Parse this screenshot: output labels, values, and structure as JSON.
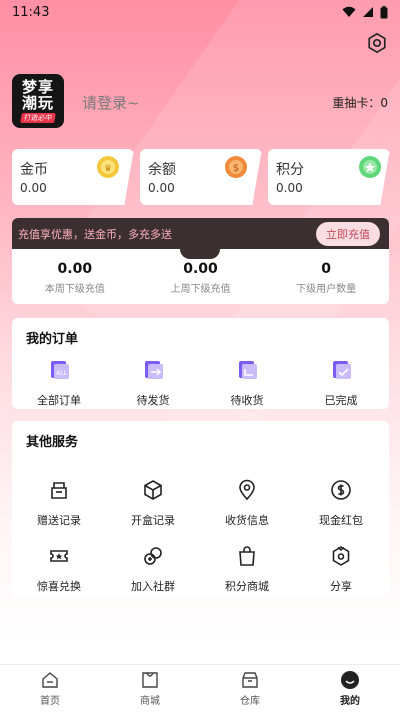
{
  "status_bar": {
    "time": "11:43"
  },
  "profile": {
    "avatar_line1": "梦享",
    "avatar_line2": "潮玩",
    "avatar_tag": "打造必中",
    "login_text": "请登录~",
    "redraw_label": "重抽卡：",
    "redraw_value": "0"
  },
  "wallet": [
    {
      "label": "金币",
      "value": "0.00",
      "icon": "gold-coin-icon",
      "color": "#f4c73a"
    },
    {
      "label": "余额",
      "value": "0.00",
      "icon": "balance-coin-icon",
      "color": "#f08a3a"
    },
    {
      "label": "积分",
      "value": "0.00",
      "icon": "points-star-icon",
      "color": "#5ed67a"
    }
  ],
  "recharge": {
    "message": "充值享优惠，送金币，多充多送",
    "button": "立即充值",
    "stats": [
      {
        "value": "0.00",
        "label": "本周下级充值"
      },
      {
        "value": "0.00",
        "label": "上周下级充值"
      },
      {
        "value": "0",
        "label": "下级用户数量"
      }
    ]
  },
  "orders": {
    "title": "我的订单",
    "items": [
      {
        "label": "全部订单",
        "icon": "all-orders-icon"
      },
      {
        "label": "待发货",
        "icon": "pending-shipment-icon"
      },
      {
        "label": "待收货",
        "icon": "pending-receipt-icon"
      },
      {
        "label": "已完成",
        "icon": "completed-icon"
      }
    ]
  },
  "services": {
    "title": "其他服务",
    "items": [
      {
        "label": "赠送记录",
        "icon": "gift-record-icon"
      },
      {
        "label": "开盒记录",
        "icon": "box-record-icon"
      },
      {
        "label": "收货信息",
        "icon": "location-icon"
      },
      {
        "label": "现金红包",
        "icon": "cash-envelope-icon"
      },
      {
        "label": "惊喜兑换",
        "icon": "ticket-icon"
      },
      {
        "label": "加入社群",
        "icon": "community-icon"
      },
      {
        "label": "积分商城",
        "icon": "shopping-bag-icon"
      },
      {
        "label": "分享",
        "icon": "share-icon"
      }
    ]
  },
  "tabbar": [
    {
      "label": "首页",
      "icon": "home-icon"
    },
    {
      "label": "商城",
      "icon": "mall-icon"
    },
    {
      "label": "仓库",
      "icon": "warehouse-icon"
    },
    {
      "label": "我的",
      "icon": "profile-icon",
      "active": true
    }
  ],
  "colors": {
    "accent": "#ff8fa3",
    "order_icon": "#7b5cf5",
    "recharge_bar": "#3b2f31"
  }
}
